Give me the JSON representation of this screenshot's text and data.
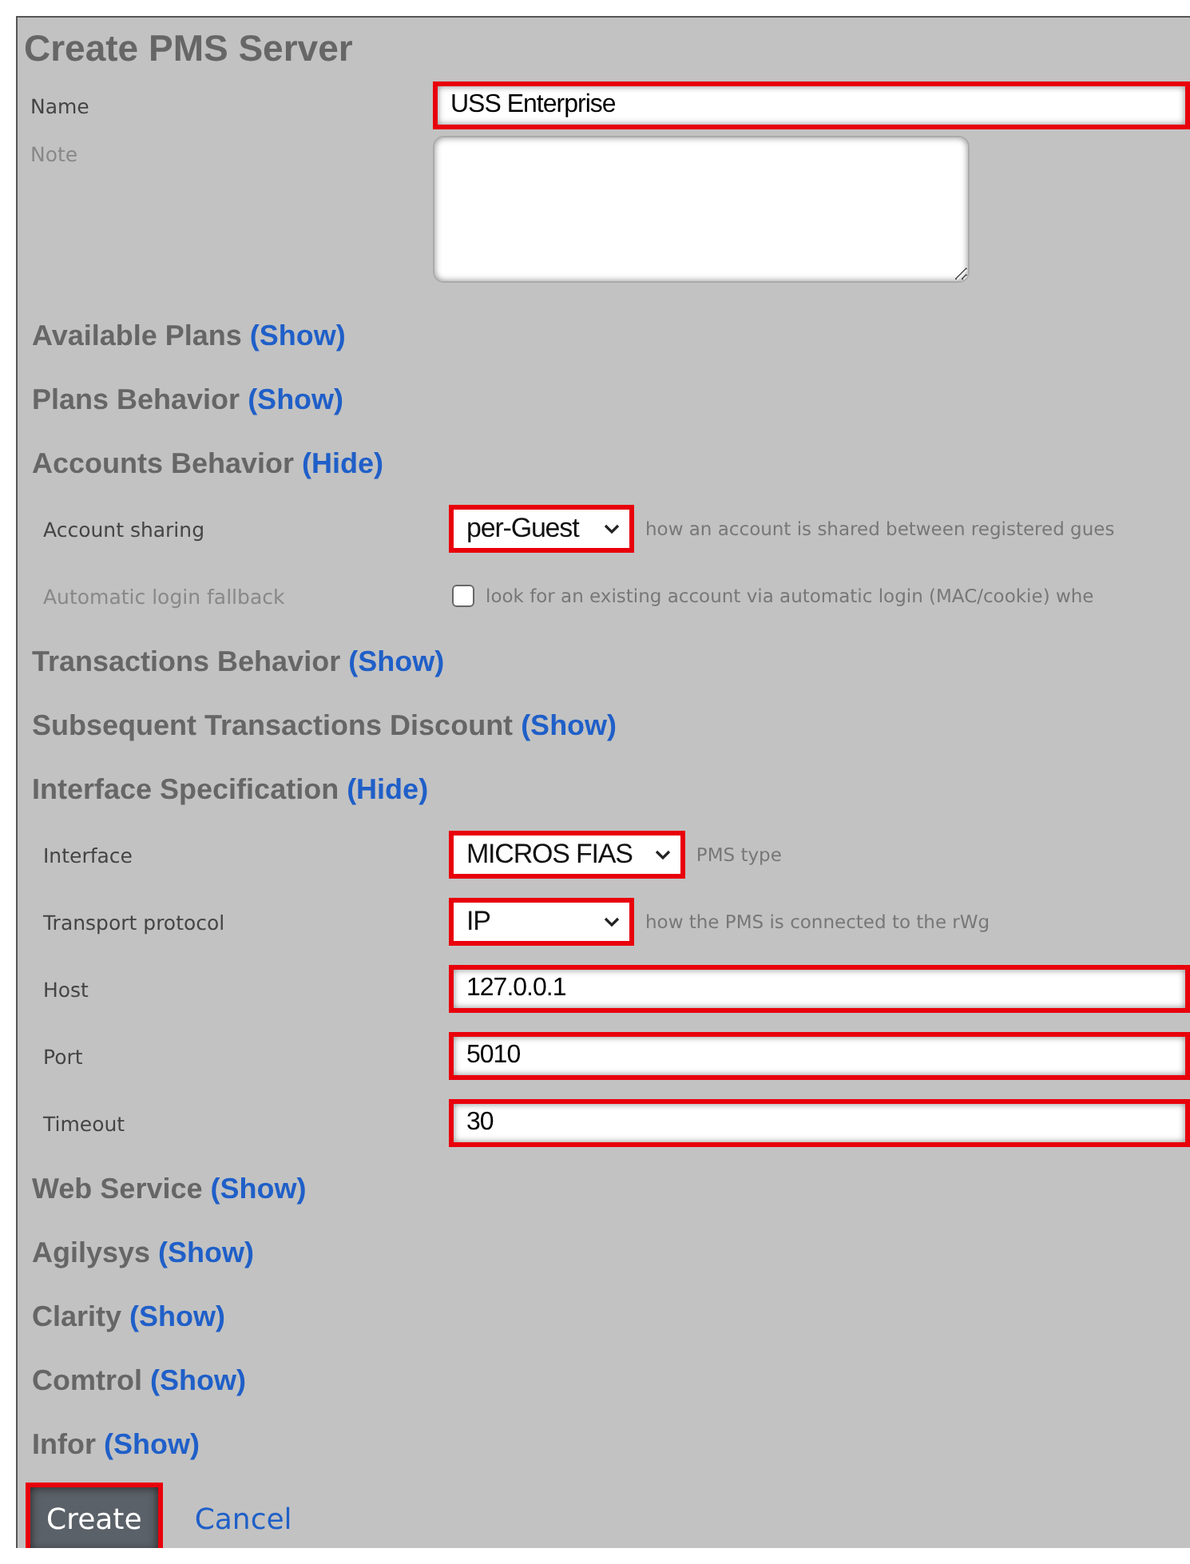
{
  "title": "Create PMS Server",
  "top_fields": [
    {
      "label": "Name",
      "kind": "text",
      "value": "USS Enterprise",
      "required": true,
      "highlighted": true
    },
    {
      "label": "Note",
      "kind": "textarea",
      "required": false,
      "highlighted": false
    }
  ],
  "sections": [
    {
      "title": "Available Plans",
      "toggle": "(Show)"
    },
    {
      "title": "Plans Behavior",
      "toggle": "(Show)"
    },
    {
      "title": "Accounts Behavior",
      "toggle": "(Hide)",
      "fields": [
        {
          "label": "Account sharing",
          "kind": "select",
          "value": "per-Guest",
          "hint": "how an account is shared between registered gues",
          "required": true,
          "highlighted": true
        },
        {
          "label": "Automatic login fallback",
          "kind": "checkbox",
          "checked": false,
          "hint": "look for an existing account via automatic login (MAC/cookie) whe",
          "required": false,
          "highlighted": false
        }
      ]
    },
    {
      "title": "Transactions Behavior",
      "toggle": "(Show)"
    },
    {
      "title": "Subsequent Transactions Discount",
      "toggle": "(Show)"
    },
    {
      "title": "Interface Specification",
      "toggle": "(Hide)",
      "fields": [
        {
          "label": "Interface",
          "kind": "select",
          "value": "MICROS FIAS",
          "hint": "PMS type",
          "required": true,
          "highlighted": true
        },
        {
          "label": "Transport protocol",
          "kind": "select",
          "value": "IP",
          "hint": "how the PMS is connected to the rWg",
          "required": true,
          "highlighted": true
        },
        {
          "label": "Host",
          "kind": "text",
          "value": "127.0.0.1",
          "required": true,
          "highlighted": true
        },
        {
          "label": "Port",
          "kind": "text",
          "value": "5010",
          "required": true,
          "highlighted": true
        },
        {
          "label": "Timeout",
          "kind": "text",
          "value": "30",
          "required": true,
          "highlighted": true
        }
      ]
    },
    {
      "title": "Web Service",
      "toggle": "(Show)"
    },
    {
      "title": "Agilysys",
      "toggle": "(Show)"
    },
    {
      "title": "Clarity",
      "toggle": "(Show)"
    },
    {
      "title": "Comtrol",
      "toggle": "(Show)"
    },
    {
      "title": "Infor",
      "toggle": "(Show)"
    }
  ],
  "buttons": [
    {
      "label": "Create",
      "kind": "primary",
      "highlighted": true
    },
    {
      "label": "Cancel",
      "kind": "link",
      "highlighted": false
    }
  ]
}
